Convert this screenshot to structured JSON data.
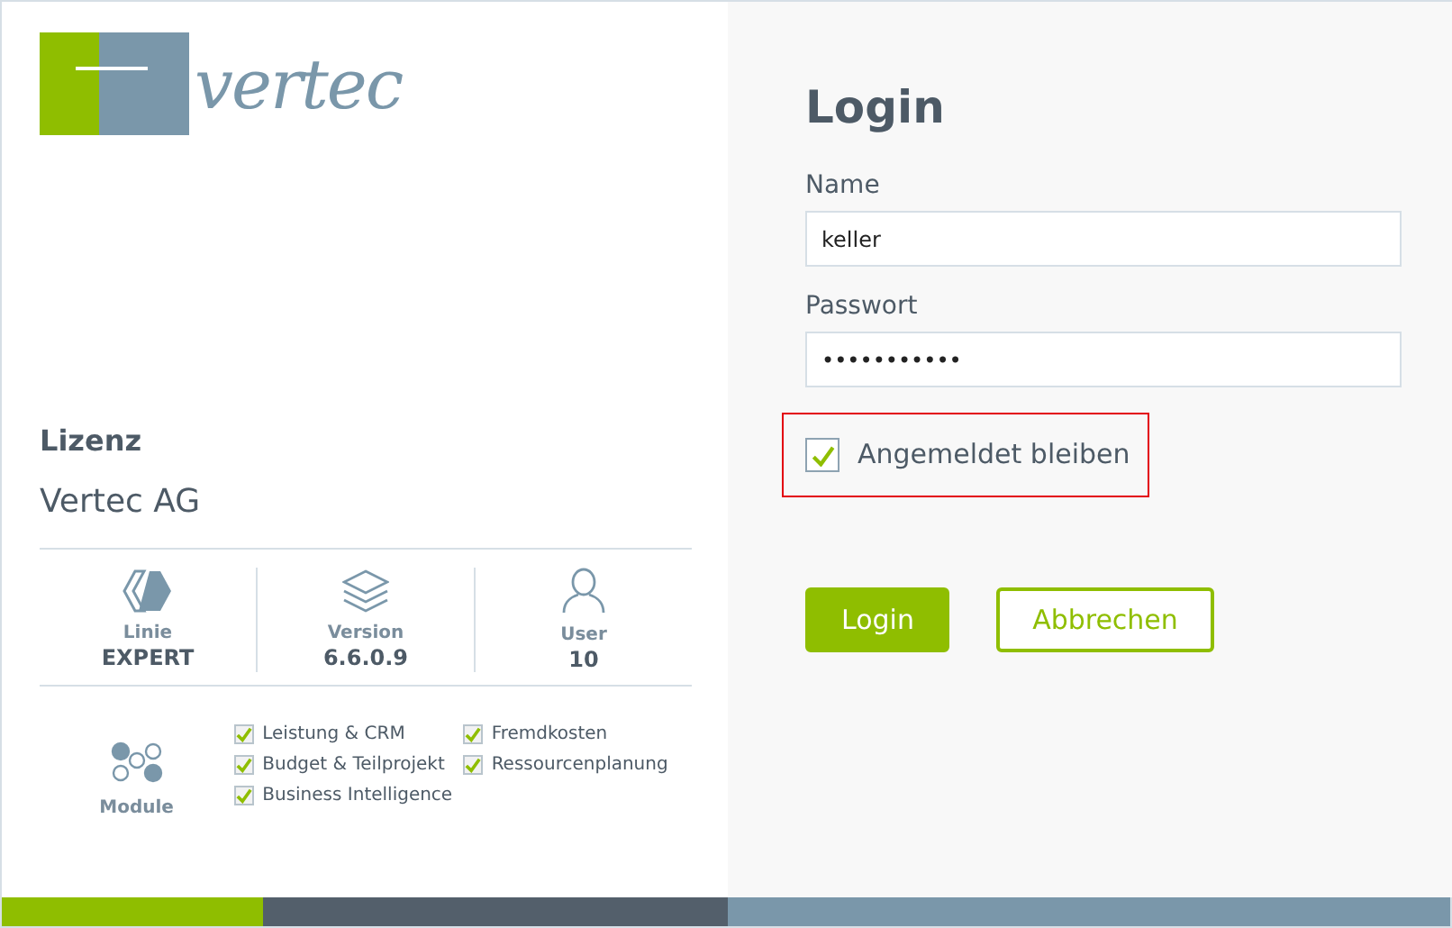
{
  "logo": {
    "text": "vertec"
  },
  "license": {
    "title": "Lizenz",
    "company": "Vertec AG",
    "stats": [
      {
        "kind": "line",
        "label": "Linie",
        "value": "EXPERT"
      },
      {
        "kind": "version",
        "label": "Version",
        "value": "6.6.0.9"
      },
      {
        "kind": "user",
        "label": "User",
        "value": "10"
      }
    ],
    "modules_label": "Module",
    "modules": [
      [
        {
          "label": "Leistung & CRM",
          "checked": true
        },
        {
          "label": "Budget & Teilprojekt",
          "checked": true
        },
        {
          "label": "Business Intelligence",
          "checked": true
        }
      ],
      [
        {
          "label": "Fremdkosten",
          "checked": true
        },
        {
          "label": "Ressourcenplanung",
          "checked": true
        }
      ]
    ]
  },
  "login": {
    "title": "Login",
    "fields": [
      {
        "label": "Name",
        "value": "keller"
      },
      {
        "label": "Passwort",
        "value": "•••••••••••"
      }
    ],
    "remember": {
      "label": "Angemeldet bleiben",
      "checked": true,
      "highlighted": true
    },
    "buttons": [
      {
        "kind": "primary",
        "label": "Login"
      },
      {
        "kind": "outline",
        "label": "Abbrechen"
      }
    ]
  }
}
